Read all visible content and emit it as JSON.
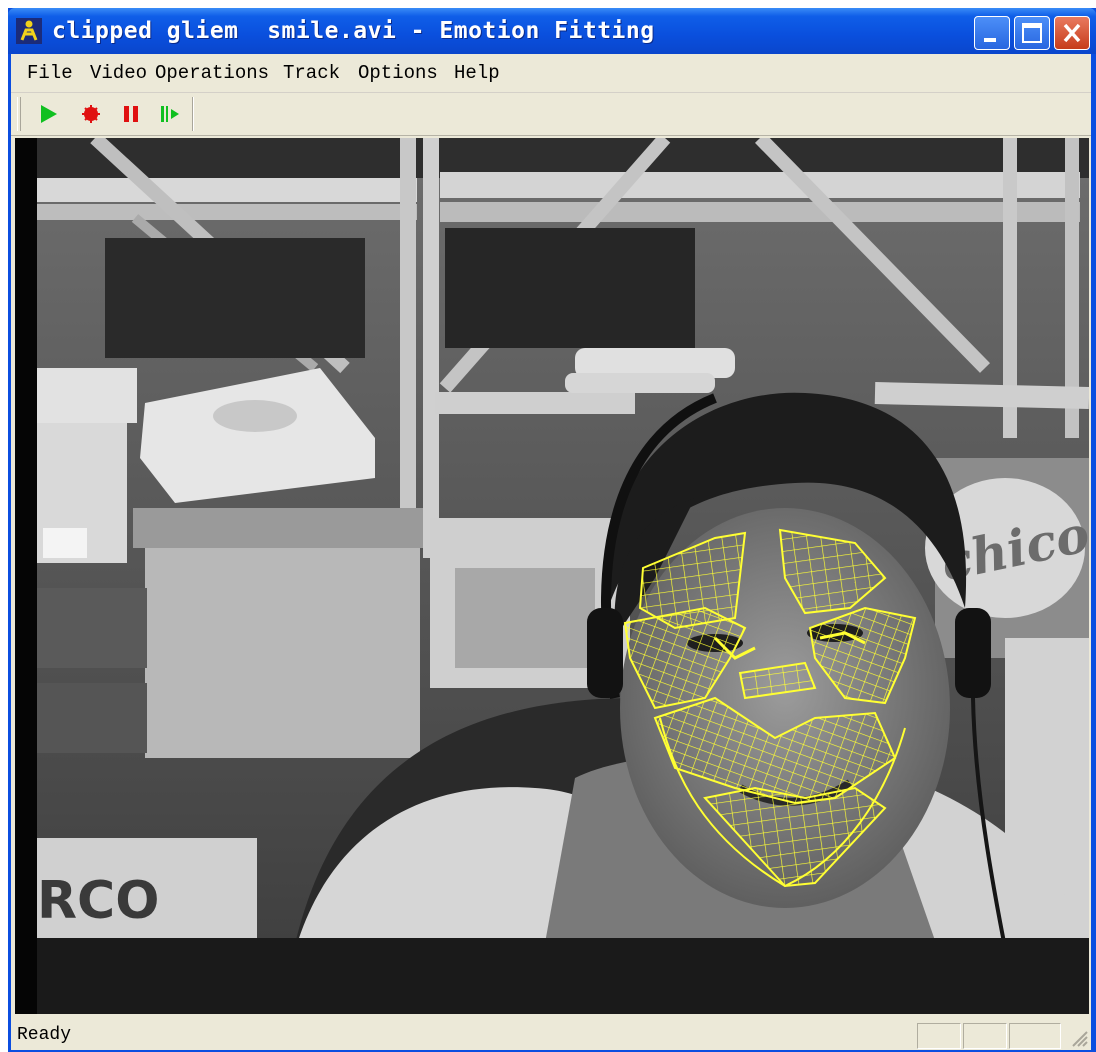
{
  "window": {
    "title": "clipped gliem  smile.avi - Emotion Fitting"
  },
  "menu": {
    "items": [
      "File",
      "Video",
      "Operations",
      "Track",
      "Options",
      "Help"
    ]
  },
  "toolbar": {
    "buttons": [
      {
        "name": "play-icon",
        "color": "#10c020"
      },
      {
        "name": "record-icon",
        "color": "#e01010"
      },
      {
        "name": "pause-icon",
        "color": "#e01010"
      },
      {
        "name": "step-forward-icon",
        "color": "#10c020"
      }
    ]
  },
  "video": {
    "overlay_color": "#ffff33",
    "background_text": "chico",
    "box_text": "RCO"
  },
  "status": {
    "text": "Ready"
  }
}
